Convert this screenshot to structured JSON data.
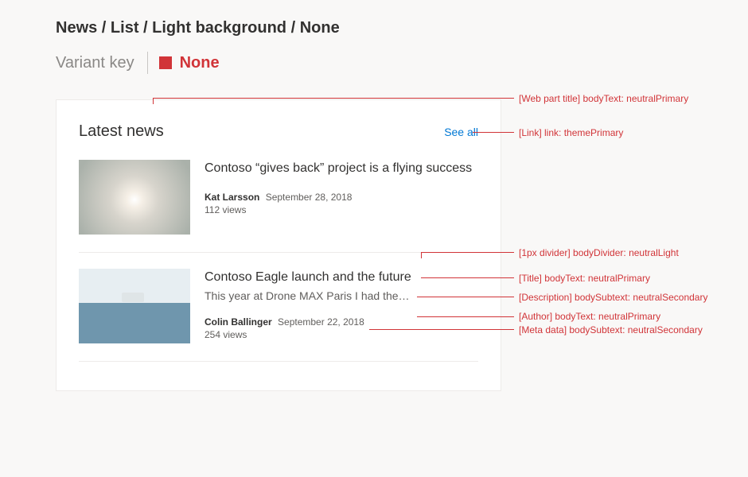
{
  "breadcrumb": "News / List / Light background / None",
  "variant": {
    "label": "Variant key",
    "value": "None",
    "swatch": "#d13438"
  },
  "webpart": {
    "title": "Latest news",
    "see_all": "See all",
    "items": [
      {
        "title": "Contoso “gives back” project is a flying success",
        "desc": "",
        "author": "Kat Larsson",
        "date": "September 28, 2018",
        "views": "112 views"
      },
      {
        "title": "Contoso Eagle launch and the future",
        "desc": "This year at Drone MAX Paris I had the…",
        "author": "Colin Ballinger",
        "date": "September 22, 2018",
        "views": "254 views"
      }
    ]
  },
  "annotations": {
    "wp_title": "[Web part title] bodyText: neutralPrimary",
    "link": "[Link] link: themePrimary",
    "divider": "[1px divider] bodyDivider: neutralLight",
    "title": "[Title] bodyText: neutralPrimary",
    "desc": "[Description] bodySubtext: neutralSecondary",
    "author": "[Author] bodyText: neutralPrimary",
    "meta": "[Meta data] bodySubtext: neutralSecondary"
  }
}
